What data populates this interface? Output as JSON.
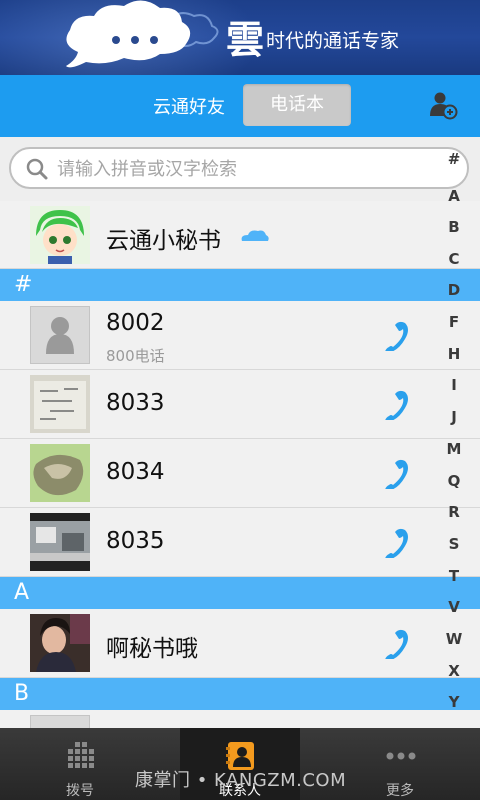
{
  "banner": {
    "cloud_char": "雲",
    "slogan": "时代的通话专家"
  },
  "tabs": {
    "friends": "云通好友",
    "phonebook": "电话本"
  },
  "search": {
    "placeholder": "请输入拼音或汉字检索"
  },
  "top_contact": {
    "name": "云通小秘书"
  },
  "sections": [
    {
      "header": "#",
      "contacts": [
        {
          "name": "8002",
          "subtitle": "800电话"
        },
        {
          "name": "8033"
        },
        {
          "name": "8034"
        },
        {
          "name": "8035"
        }
      ]
    },
    {
      "header": "A",
      "contacts": [
        {
          "name": "啊秘书哦"
        }
      ]
    },
    {
      "header": "B",
      "contacts": []
    }
  ],
  "alphabet_index": [
    "#",
    "A",
    "B",
    "C",
    "D",
    "F",
    "H",
    "I",
    "J",
    "M",
    "Q",
    "R",
    "S",
    "T",
    "V",
    "W",
    "X",
    "Y"
  ],
  "bottom_nav": {
    "dial": "拨号",
    "contacts": "联系人",
    "more": "更多"
  },
  "watermark": "康掌门 • KANGZM.COM",
  "colors": {
    "accent": "#1d9cf0",
    "section": "#4fb3f8",
    "banner": "#23489a"
  }
}
